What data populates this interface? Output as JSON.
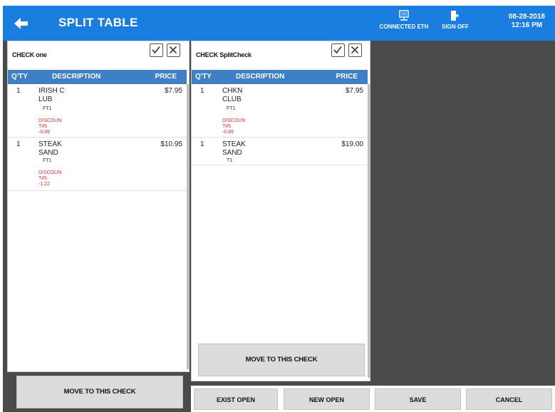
{
  "header": {
    "title": "SPLIT TABLE",
    "connection_label": "CONNECTED ETH",
    "signoff_label": "SIGN OFF",
    "date": "08-28-2018",
    "time": "12:16 PM"
  },
  "columns": {
    "qty": "Q'TY",
    "description": "DESCRIPTION",
    "price": "PRICE"
  },
  "checks": [
    {
      "name": "CHECK one",
      "move_label": "MOVE TO THIS CHECK",
      "items": [
        {
          "qty": "1",
          "desc_line1": "IRISH C",
          "desc_line2": "LUB",
          "modifier": "FT1",
          "price": "$7.95",
          "discount": [
            "DISCOUN",
            "T#5",
            "-0.89"
          ]
        },
        {
          "qty": "1",
          "desc_line1": "STEAK",
          "desc_line2": "SAND",
          "modifier": "FT1",
          "price": "$10.95",
          "discount": [
            "DISCOUN",
            "T#5",
            "-1.22"
          ]
        }
      ]
    },
    {
      "name": "CHECK SplitCheck",
      "move_label": "MOVE TO THIS CHECK",
      "items": [
        {
          "qty": "1",
          "desc_line1": "CHKN",
          "desc_line2": "CLUB",
          "modifier": "FT1",
          "price": "$7.95",
          "discount": [
            "DISCOUN",
            "T#5",
            "-0.89"
          ]
        },
        {
          "qty": "1",
          "desc_line1": "STEAK",
          "desc_line2": "SAND",
          "modifier": "T1",
          "price": "$19.00"
        }
      ]
    }
  ],
  "actions": {
    "exist_open": "EXIST OPEN",
    "new_open": "NEW OPEN",
    "save": "SAVE",
    "cancel": "CANCEL"
  },
  "colors": {
    "header_bar": "#1a7ee0",
    "column_header": "#3e7fc6",
    "discount_text": "#e03030",
    "background": "#4a4a4a"
  },
  "icons": [
    "back-arrow-icon",
    "network-icon",
    "sign-off-icon",
    "check-icon",
    "close-icon"
  ]
}
